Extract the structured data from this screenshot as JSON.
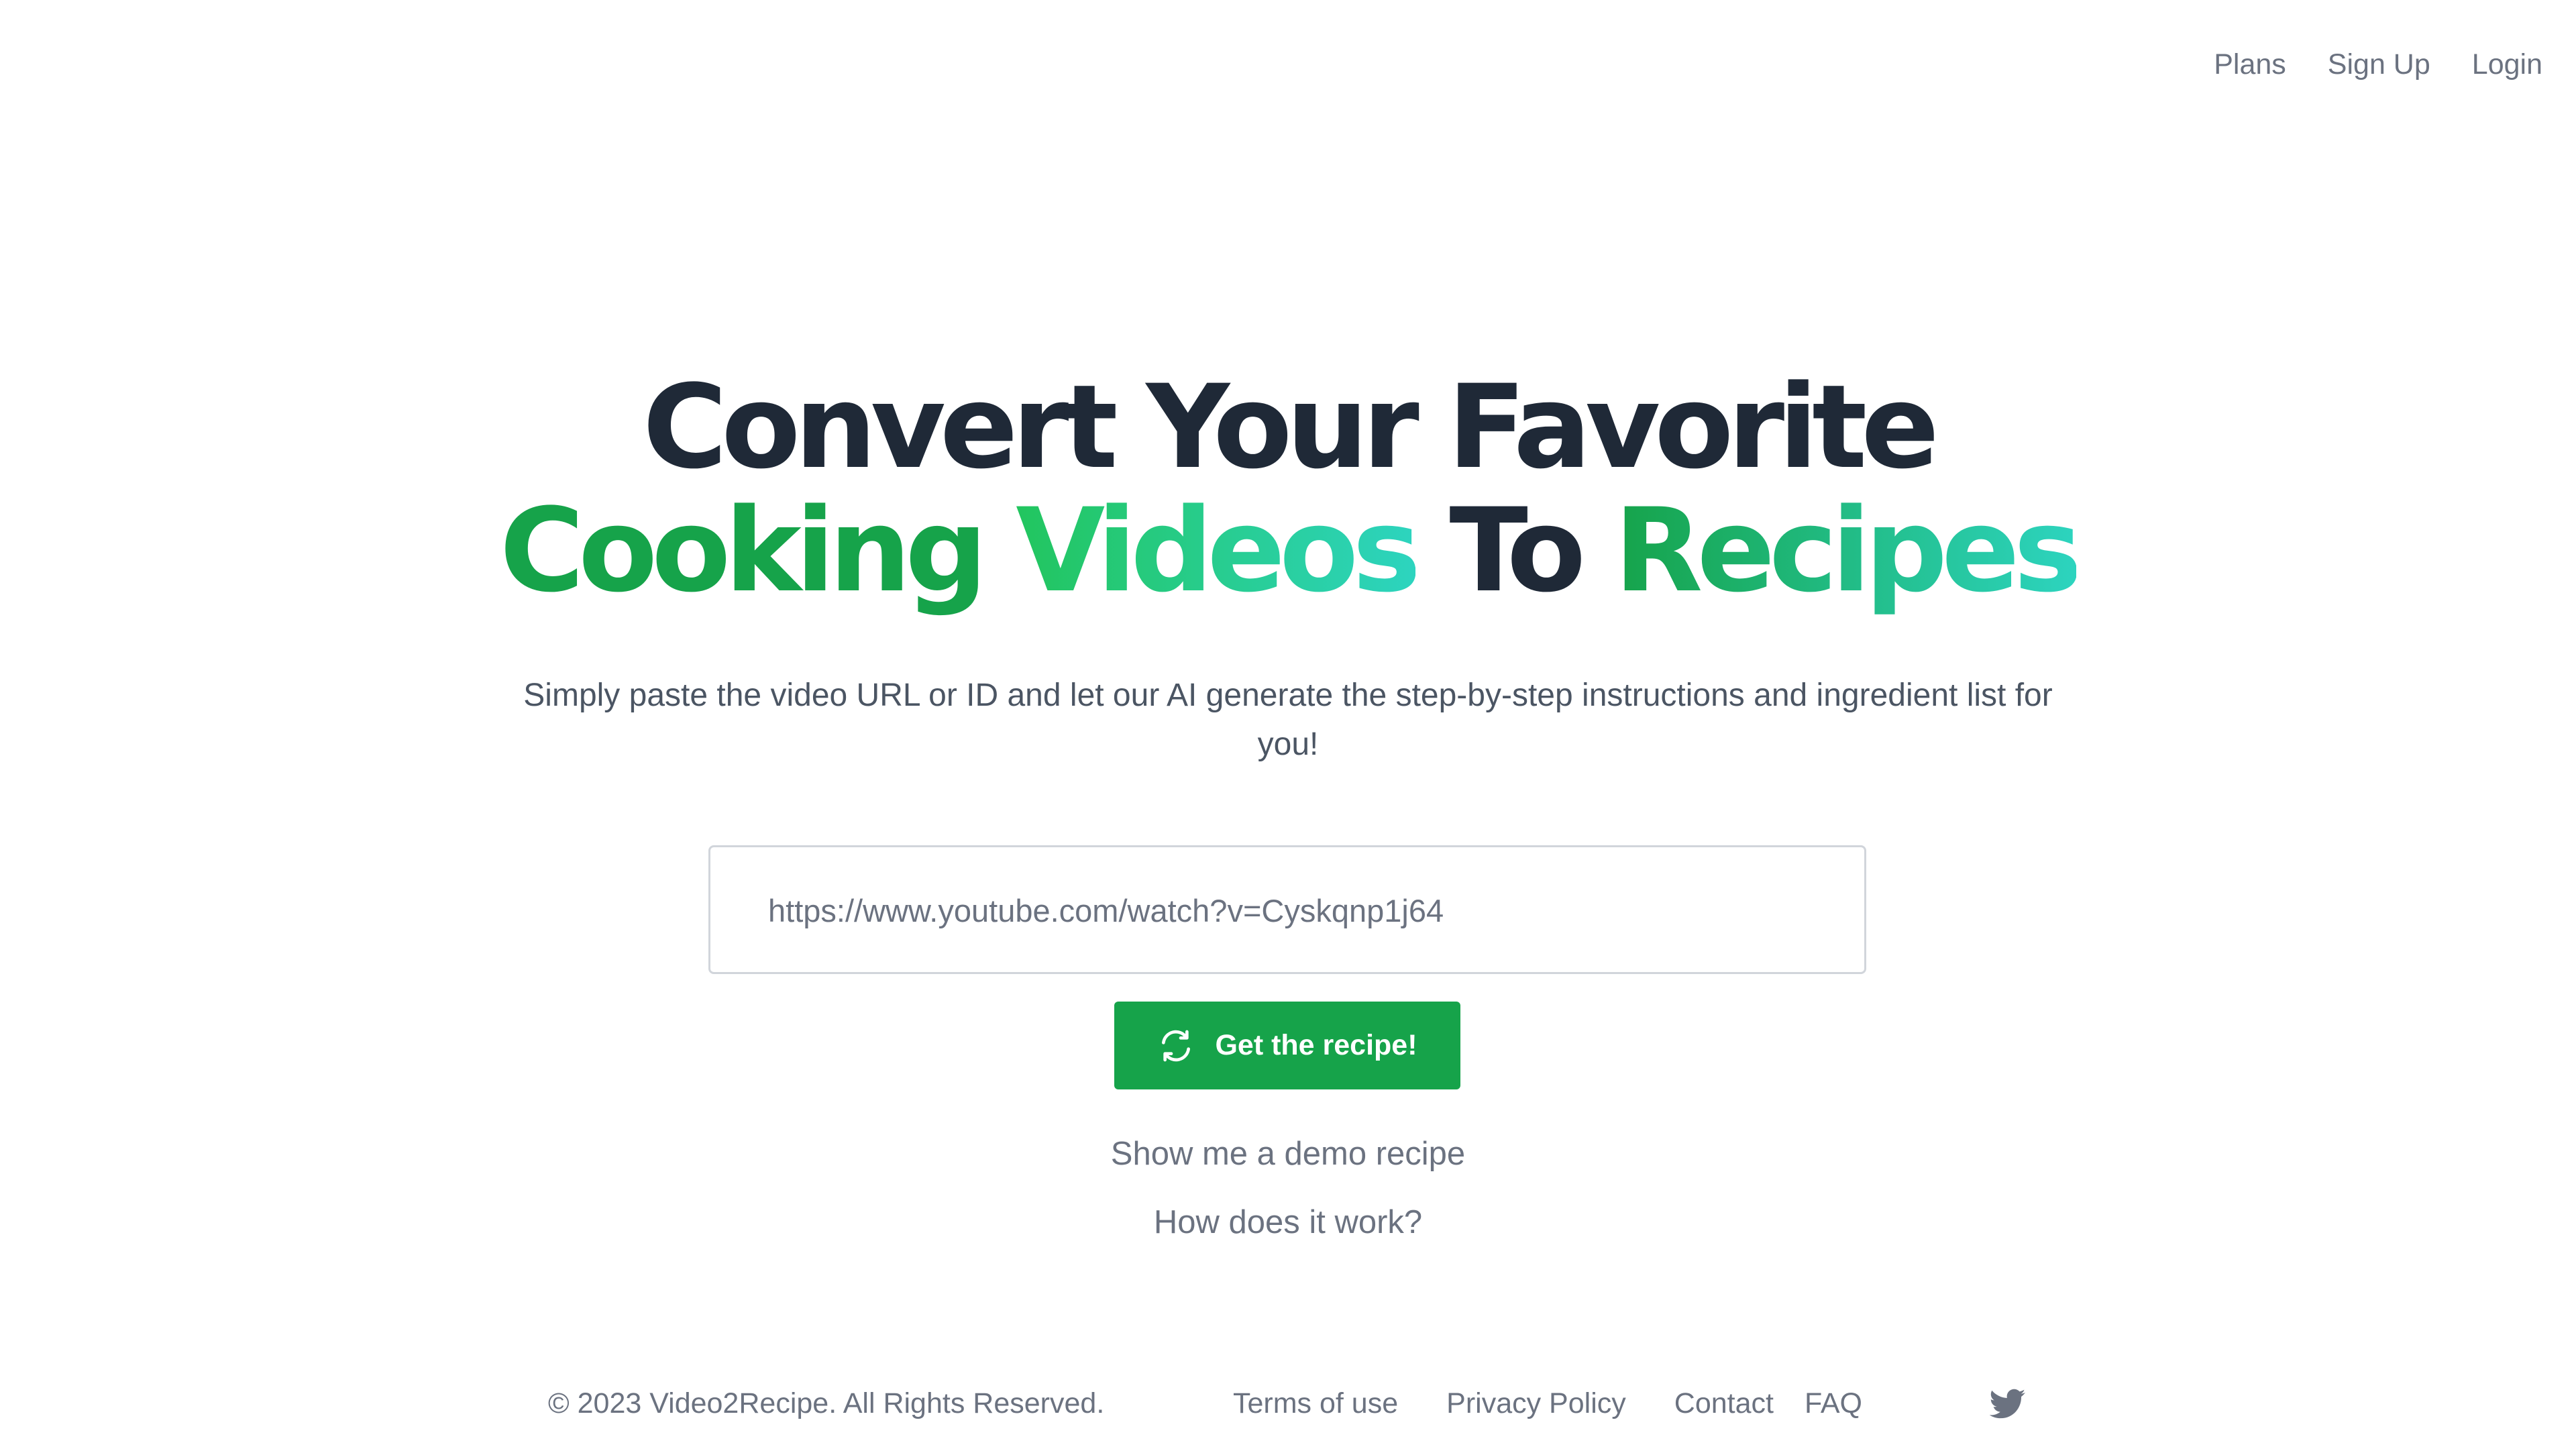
{
  "nav": {
    "plans": "Plans",
    "signup": "Sign Up",
    "login": "Login"
  },
  "hero": {
    "line1": "Convert Your Favorite",
    "word_cooking": "Cooking",
    "word_videos": "Videos",
    "word_to": "To",
    "word_recipes": "Recipes",
    "subtitle": "Simply paste the video URL or ID and let our AI generate the step-by-step instructions and ingredient list for you!"
  },
  "form": {
    "url_placeholder": "https://www.youtube.com/watch?v=Cyskqnp1j64",
    "submit_label": "Get the recipe!",
    "submit_icon": "refresh-icon"
  },
  "links": {
    "demo": "Show me a demo recipe",
    "how": "How does it work?"
  },
  "footer": {
    "copyright": "© 2023 Video2Recipe. All Rights Reserved.",
    "terms": "Terms of use",
    "privacy": "Privacy Policy",
    "contact": "Contact",
    "faq": "FAQ",
    "social_icon": "twitter-icon"
  },
  "colors": {
    "brand_green": "#16a34a",
    "teal": "#2dd4bf",
    "heading_dark": "#1f2937",
    "muted_text": "#6b7280"
  }
}
